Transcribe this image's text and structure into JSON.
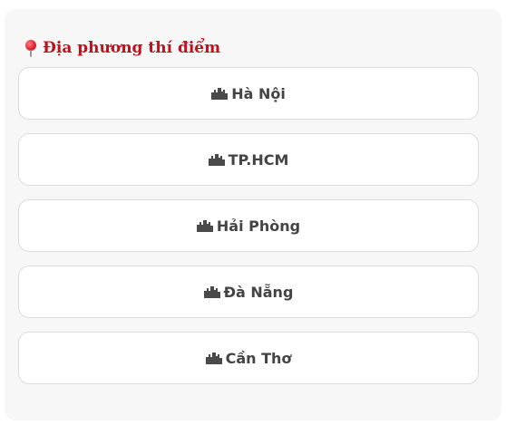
{
  "section": {
    "icon": "round-pushpin-icon",
    "title": "Địa phương thí điểm",
    "title_color": "#c0101e"
  },
  "cities": [
    {
      "label": "Hà Nội",
      "icon": "cityscape-icon"
    },
    {
      "label": "TP.HCM",
      "icon": "cityscape-icon"
    },
    {
      "label": "Hải Phòng",
      "icon": "cityscape-icon"
    },
    {
      "label": "Đà Nẵng",
      "icon": "cityscape-icon"
    },
    {
      "label": "Cần Thơ",
      "icon": "cityscape-icon"
    }
  ]
}
